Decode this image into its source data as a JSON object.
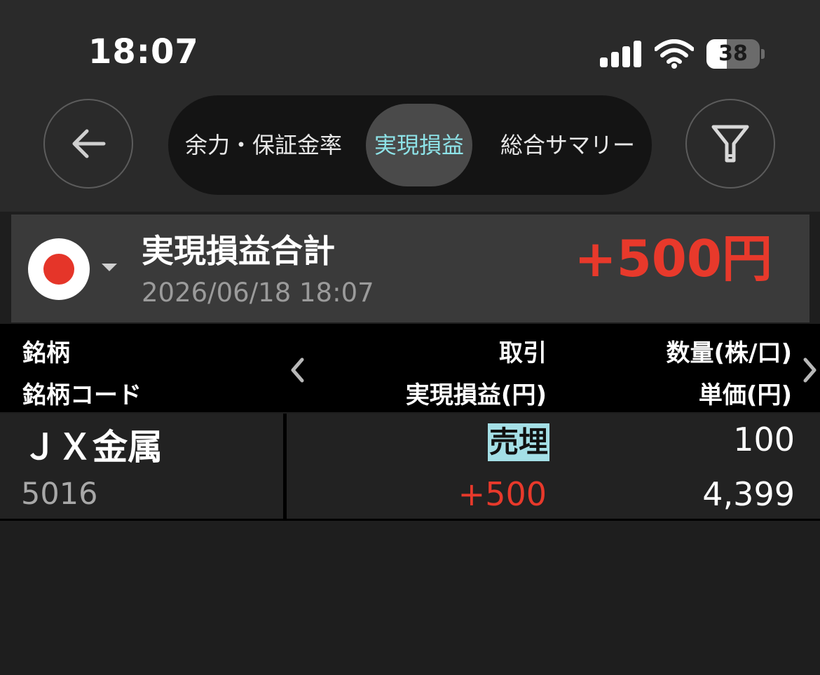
{
  "status_bar": {
    "time": "18:07",
    "battery_percent": "38",
    "battery_level": 0.38,
    "icons": [
      "cellular-signal-icon",
      "wifi-icon",
      "battery-icon"
    ]
  },
  "nav": {
    "back_icon": "arrow-left-icon",
    "filter_icon": "filter-icon",
    "tabs": [
      {
        "label": "余力・保証金率",
        "active": false
      },
      {
        "label": "実現損益",
        "active": true
      },
      {
        "label": "総合サマリー",
        "active": false
      }
    ],
    "active_color": "#8ee3e8"
  },
  "summary": {
    "market_icon": "japan-flag-icon",
    "title": "実現損益合計",
    "datetime": "2026/06/18 18:07",
    "total": "+500円",
    "total_color": "#e8392b"
  },
  "table": {
    "headers": {
      "col1_line1": "銘柄",
      "col1_line2": "銘柄コード",
      "col2_line1": "取引",
      "col2_line2": "実現損益(円)",
      "col3_line1": "数量(株/口)",
      "col3_line2": "単価(円)"
    },
    "rows": [
      {
        "name": "ＪＸ金属",
        "code": "5016",
        "trade_type": "売埋",
        "realized_pnl": "+500",
        "quantity": "100",
        "unit_price": "4,399"
      }
    ],
    "trade_badge_color": "#a4dfe6",
    "profit_color": "#e8392b"
  }
}
